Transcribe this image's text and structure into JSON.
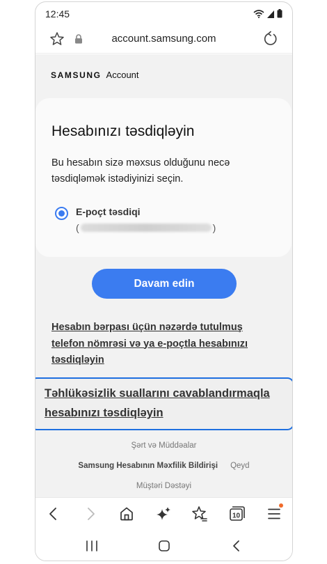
{
  "status_bar": {
    "time": "12:45"
  },
  "browser": {
    "url": "account.samsung.com"
  },
  "brand": {
    "samsung": "SAMSUNG",
    "account": "Account"
  },
  "card": {
    "title": "Hesabınızı təsdiqləyin",
    "description": "Bu hesabın sizə məxsus olduğunu necə təsdiqləmək istədiyinizi seçin.",
    "option_label": "E-poçt təsdiqi",
    "option_email_open": "(",
    "option_email_close": ")"
  },
  "continue_button": "Davam edin",
  "links": {
    "recovery_phone_email": "Hesabın bərpası üçün nəzərdə tutulmuş telefon nömrəsi və ya e-poçtla hesabınızı təsdiqləyin",
    "security_questions": "Təhlükəsizlik suallarını cavablandırmaqla hesabınızı təsdiqləyin"
  },
  "footer": {
    "terms": "Şərt və Müddəalar",
    "privacy": "Samsung Hesabının Məxfilik Bildirişi",
    "notice": "Qeyd",
    "support": "Müştəri Dəstəyi"
  },
  "icons": {
    "star": "star-icon",
    "lock": "lock-icon",
    "reload": "reload-icon",
    "back": "chevron-left-icon",
    "forward": "chevron-right-icon",
    "home": "home-icon",
    "sparkle": "sparkle-icon",
    "bookmarks": "bookmark-star-icon",
    "tabs": "tabs-icon",
    "menu": "menu-icon"
  },
  "tabs_count": "10",
  "colors": {
    "accent": "#3b7cf0",
    "highlight_border": "#1e6fe0",
    "page_background": "#f2f2f2",
    "menu_badge": "#f06a2a"
  }
}
